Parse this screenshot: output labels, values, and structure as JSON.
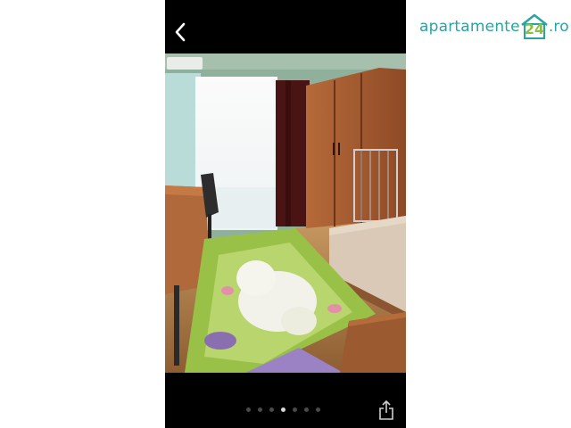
{
  "brand": {
    "name_part1": "apartamente",
    "name_number": "24",
    "name_tld": ".ro",
    "colors": {
      "teal": "#2aa3a3",
      "green": "#8ac13f"
    }
  },
  "viewer": {
    "back_icon": "chevron-left-icon",
    "share_icon": "share-icon",
    "pagination": {
      "total": 7,
      "current": 4
    }
  }
}
